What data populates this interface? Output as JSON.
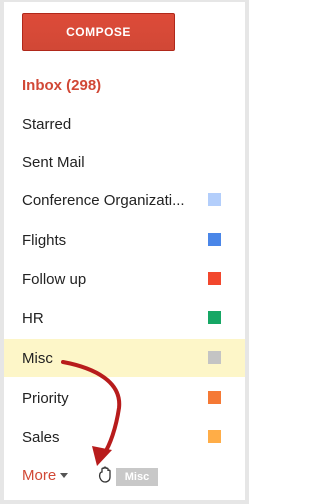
{
  "compose": {
    "label": "COMPOSE"
  },
  "nav": {
    "inbox": "Inbox (298)",
    "starred": "Starred",
    "sent": "Sent Mail"
  },
  "labels": [
    {
      "name": "Conference Organizati...",
      "color": "#b3cefb"
    },
    {
      "name": "Flights",
      "color": "#4a86e8"
    },
    {
      "name": "Follow up",
      "color": "#f2472d"
    },
    {
      "name": "HR",
      "color": "#16a765"
    },
    {
      "name": "Misc",
      "color": "#c4c4c4",
      "selected": true
    },
    {
      "name": "Priority",
      "color": "#f57935"
    },
    {
      "name": "Sales",
      "color": "#ffad47"
    }
  ],
  "more": {
    "label": "More"
  },
  "drag": {
    "tag_label": "Misc",
    "cursor_icon": "grab-hand-icon"
  },
  "annotation": {
    "arrow_color": "#b81c1c"
  }
}
